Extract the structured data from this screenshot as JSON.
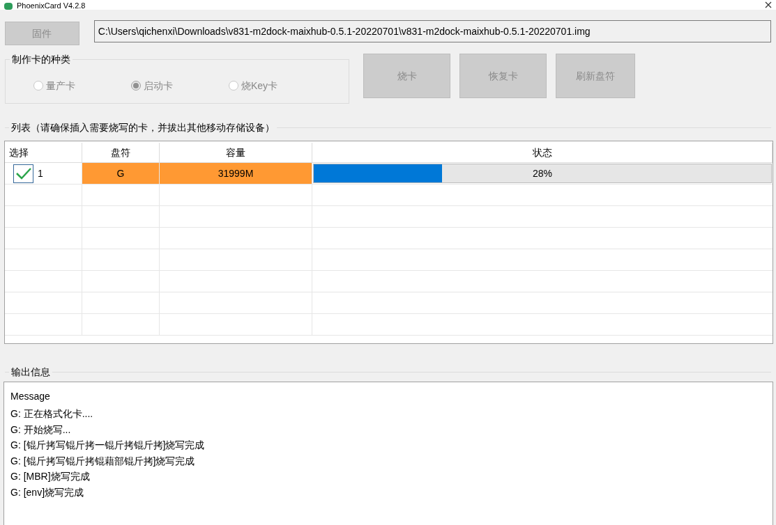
{
  "window": {
    "title": "PhoenixCard V4.2.8"
  },
  "firmware_button": {
    "label": "固件",
    "disabled": true
  },
  "firmware_path": {
    "value": "C:\\Users\\qichenxi\\Downloads\\v831-m2dock-maixhub-0.5.1-20220701\\v831-m2dock-maixhub-0.5.1-20220701.img"
  },
  "card_type": {
    "title": "制作卡的种类",
    "options": [
      {
        "label": "量产卡",
        "selected": false
      },
      {
        "label": "启动卡",
        "selected": true
      },
      {
        "label": "烧Key卡",
        "selected": false
      }
    ]
  },
  "actions": [
    {
      "label": "烧卡",
      "disabled": true
    },
    {
      "label": "恢复卡",
      "disabled": true
    },
    {
      "label": "刷新盘符",
      "disabled": true
    }
  ],
  "list": {
    "title": "列表（请确保插入需要烧写的卡，并拔出其他移动存储设备）",
    "columns": [
      "选择",
      "盘符",
      "容量",
      "状态"
    ],
    "rows": [
      {
        "checked": true,
        "index": "1",
        "drive": "G",
        "capacity": "31999M",
        "level": 0.28,
        "progress": "28%",
        "color": "#ff9933"
      }
    ]
  },
  "output": {
    "title": "输出信息",
    "header": "Message",
    "lines": [
      "G: 正在格式化卡....",
      "G: 开始烧写...",
      "G: [锟斤拷写锟斤拷一锟斤拷锟斤拷]烧写完成",
      "G: [锟斤拷写锟斤拷锟藉部锟斤拷]烧写完成",
      "G: [MBR]烧写完成",
      "G: [env]烧写完成"
    ]
  }
}
